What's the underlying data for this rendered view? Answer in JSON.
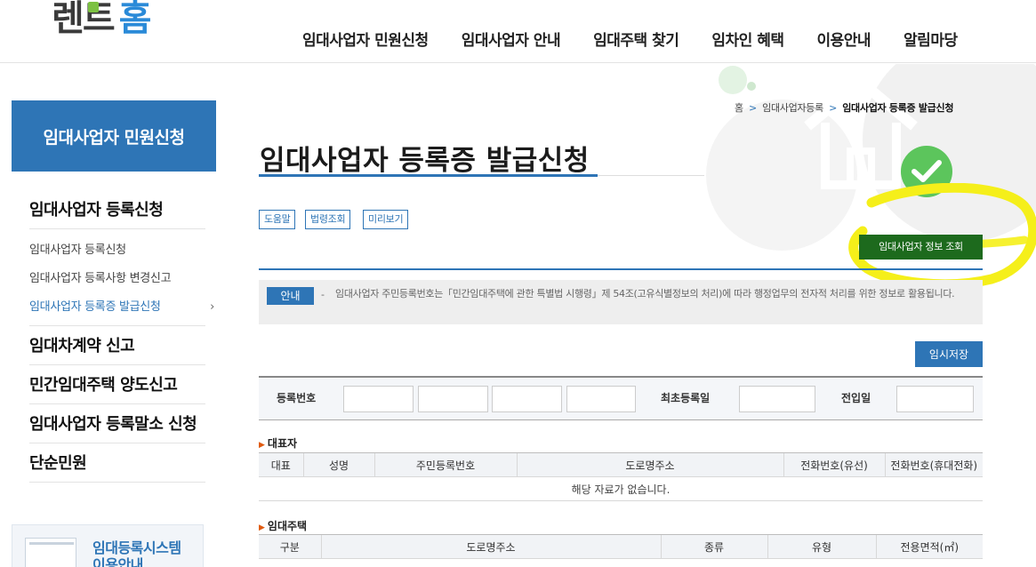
{
  "logo": {
    "part1": "렌",
    "part2": "트",
    "part3": "홈"
  },
  "nav": [
    "임대사업자 민원신청",
    "임대사업자 안내",
    "임대주택 찾기",
    "임차인 혜택",
    "이용안내",
    "알림마당"
  ],
  "sidebar": {
    "title": "임대사업자 민원신청",
    "group1": {
      "label": "임대사업자 등록신청",
      "items": [
        "임대사업자 등록신청",
        "임대사업자 등록사항 변경신고",
        "임대사업자 등록증 발급신청"
      ],
      "arrow": "›"
    },
    "group2": "임대차계약 신고",
    "group3": "민간임대주택 양도신고",
    "group4": "임대사업자 등록말소 신청",
    "group5": "단순민원",
    "banner": {
      "line1": "임대등록시스템",
      "line2": "이용안내"
    }
  },
  "breadcrumb": {
    "home": "홈",
    "sep": ">",
    "level1": "임대사업자등록",
    "current": "임대사업자 등록증 발급신청"
  },
  "page_title": "임대사업자 등록증 발급신청",
  "buttons": {
    "help": "도움말",
    "law": "법령조회",
    "preview": "미리보기",
    "lookup": "임대사업자 정보 조회",
    "save": "임시저장"
  },
  "notice": {
    "tag": "안내",
    "dash": "-",
    "text": "임대사업자 주민등록번호는「민간임대주택에 관한 특별법 시행령」제 54조(고유식별정보의 처리)에 따라 행정업무의 전자적 처리를 위한 정보로 활용됩니다."
  },
  "registration": {
    "reg_no_label": "등록번호",
    "first_reg_label": "최초등록일",
    "transfer_label": "전입일"
  },
  "representative": {
    "title": "대표자",
    "columns": [
      "대표",
      "성명",
      "주민등록번호",
      "도로명주소",
      "전화번호(유선)",
      "전화번호(휴대전화)"
    ],
    "empty": "해당 자료가 없습니다."
  },
  "rental_house": {
    "title": "임대주택",
    "columns": [
      "구분",
      "도로명주소",
      "종류",
      "유형",
      "전용면적(㎡)"
    ]
  },
  "colors": {
    "primary": "#2e75b6",
    "green_button": "#1d6a1d",
    "highlight": "#f5ef1a",
    "check": "#5cc55c"
  }
}
